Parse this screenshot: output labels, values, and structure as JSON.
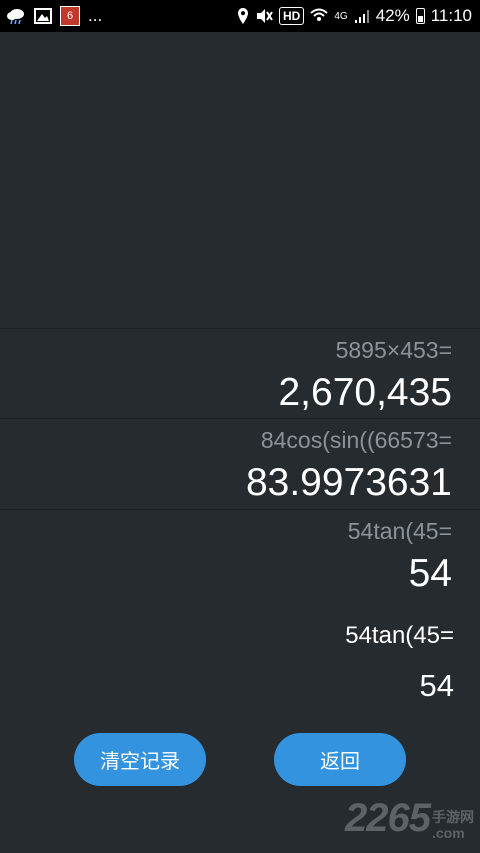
{
  "status_bar": {
    "notification_badge": "6",
    "overflow": "...",
    "network_hd": "HD",
    "network_type": "4G",
    "battery": "42%",
    "time": "11:10"
  },
  "history": [
    {
      "expression": "5895×453=",
      "result": "2,670,435"
    },
    {
      "expression": "84cos(sin((66573=",
      "result": "83.9973631"
    },
    {
      "expression": "54tan(45=",
      "result": "54"
    }
  ],
  "current": {
    "expression": "54tan(45=",
    "result": "54"
  },
  "buttons": {
    "clear_history": "清空记录",
    "back": "返回"
  },
  "watermark": {
    "number": "2265",
    "suffix_top": "手游网",
    "suffix_bottom": ".com"
  },
  "colors": {
    "background": "#262b30",
    "button": "#3393de",
    "expression_text": "#8c9398"
  }
}
